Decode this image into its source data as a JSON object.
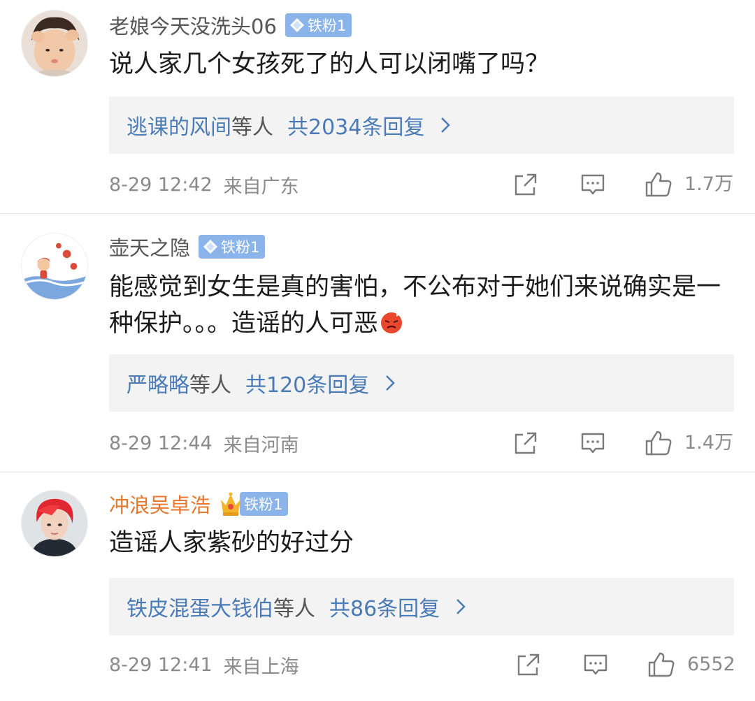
{
  "comments": [
    {
      "username": "老娘今天没洗头06",
      "badge": "铁粉1",
      "text": "说人家几个女孩死了的人可以闭嘴了吗？",
      "reply_users": "逃课的风间",
      "reply_suffix": "等人",
      "reply_count": "共2034条回复",
      "time": "8-29 12:42",
      "location": "来自广东",
      "likes": "1.7万"
    },
    {
      "username": "壶天之隐",
      "badge": "铁粉1",
      "text": "能感觉到女生是真的害怕，不公布对于她们来说确实是一种保护。。。造谣的人可恶",
      "emoji": "anger-emoji",
      "reply_users": "严略略",
      "reply_suffix": "等人",
      "reply_count": "共120条回复",
      "time": "8-29 12:44",
      "location": "来自河南",
      "likes": "1.4万"
    },
    {
      "username": "冲浪吴卓浩",
      "badge": "铁粉1",
      "vip": true,
      "text": "造谣人家紫砂的好过分",
      "reply_users": "铁皮混蛋大钱伯",
      "reply_suffix": "等人",
      "reply_count": "共86条回复",
      "time": "8-29 12:41",
      "location": "来自上海",
      "likes": "6552"
    }
  ],
  "icons": {
    "share": "share-icon",
    "comment": "comment-icon",
    "like": "thumbs-up-icon",
    "chevron": "chevron-right-icon",
    "badge": "diamond-icon",
    "vip": "crown-icon"
  },
  "colors": {
    "link": "#4a7bb6",
    "vip_name": "#e8772e",
    "badge_bg": "#8ab4ea",
    "reply_bg": "#f3f3f3",
    "meta": "#8a8a8a"
  }
}
